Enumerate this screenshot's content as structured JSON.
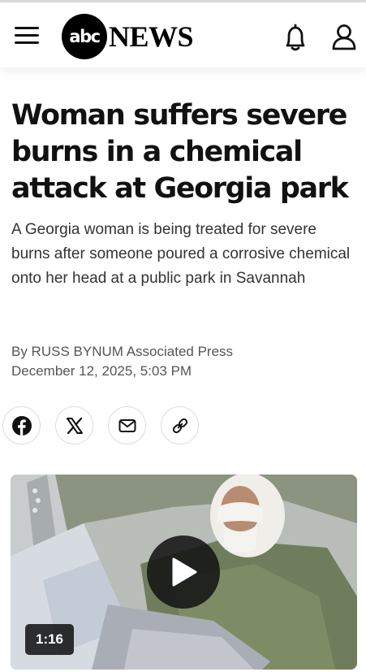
{
  "header": {
    "logo_circle_text": "abc",
    "logo_text": "NEWS",
    "icons": [
      "menu-icon",
      "bell-icon",
      "user-icon"
    ]
  },
  "article": {
    "headline": "Woman suffers severe burns in a chemical attack at Georgia park",
    "subheadline": "A Georgia woman is being treated for severe burns after someone poured a corrosive chemical onto her head at a public park in Savannah",
    "byline": "By RUSS BYNUM Associated Press",
    "date": "December 12, 2025, 5:03 PM"
  },
  "share": {
    "icons": [
      "facebook-icon",
      "x-icon",
      "email-icon",
      "link-icon"
    ]
  },
  "video": {
    "duration": "1:16",
    "icon": "play-icon"
  },
  "colors": {
    "text": "#111111",
    "byline": "#555555",
    "logo_background": "#000000"
  }
}
